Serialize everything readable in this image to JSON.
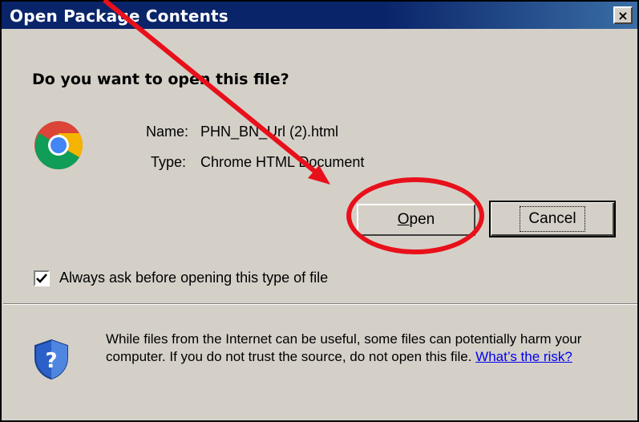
{
  "dialog": {
    "title": "Open Package Contents",
    "close_glyph": "×",
    "question": "Do you want to open this file?",
    "file": {
      "name_label": "Name:",
      "name_value": "PHN_BN_Url (2).html",
      "type_label": "Type:",
      "type_value": "Chrome HTML Document",
      "icon": "chrome-icon"
    },
    "buttons": {
      "open_label": "Open",
      "cancel_label": "Cancel"
    },
    "checkbox": {
      "label": "Always ask before opening this type of file",
      "checked": true
    },
    "warning": {
      "text": "While files from the Internet can be useful, some files can potentially harm your computer. If you do not trust the source, do not open this file.",
      "link": "What’s the risk?",
      "icon": "shield-question-icon"
    }
  },
  "annotations": {
    "arrow_color": "#e8101a",
    "highlight_color": "#e8101a"
  }
}
